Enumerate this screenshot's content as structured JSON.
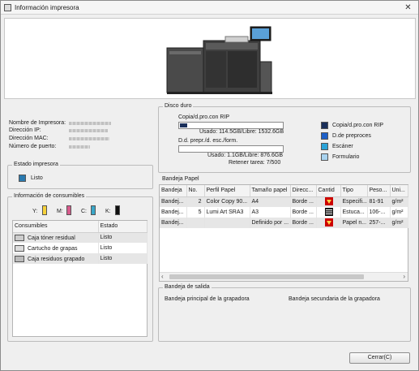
{
  "window": {
    "title": "Información impresora",
    "close_glyph": "✕"
  },
  "printer": {
    "name_label": "Nombre de Impresora:",
    "ip_label": "Dirección IP:",
    "mac_label": "Dirección MAC:",
    "port_label": "Número de puerto:"
  },
  "status": {
    "legend": "Estado impresora",
    "value": "Listo",
    "color": "#2a7ab0"
  },
  "consumables": {
    "legend": "Información de consumibles",
    "toners": [
      {
        "label": "Y:",
        "color": "#f6d13a",
        "level": 0.85
      },
      {
        "label": "M:",
        "color": "#d75b8c",
        "level": 0.85
      },
      {
        "label": "C:",
        "color": "#3aa7c9",
        "level": 0.85
      },
      {
        "label": "K:",
        "color": "#111111",
        "level": 0.85
      }
    ],
    "columns": [
      "Consumibles",
      "Estado"
    ],
    "rows": [
      {
        "name": "Caja tóner residual",
        "state": "Listo"
      },
      {
        "name": "Cartucho de grapas",
        "state": "Listo"
      },
      {
        "name": "Caja residuos grapado",
        "state": "Listo"
      }
    ]
  },
  "disk": {
    "legend": "Disco duro",
    "copy_label": "Copia/d.pro.con RIP",
    "copy_usage": "Usado: 114.5GB/Libre: 1532.6GB",
    "copy_fraction": 0.07,
    "form_label": "D.d. prepr./d. esc./form.",
    "form_usage": "Usado: 1.1GB/Libre: 876.6GB",
    "form_fraction": 0.0,
    "retain": "Retener tarea: 7/500",
    "legend_items": [
      {
        "label": "Copia/d.pro.con RIP",
        "color": "#1a2f5a"
      },
      {
        "label": "D.de preproces",
        "color": "#1d60c8"
      },
      {
        "label": "Escáner",
        "color": "#2ba3d8"
      },
      {
        "label": "Formulario",
        "color": "#a9d3ef"
      }
    ]
  },
  "trays": {
    "legend": "Bandeja Papel",
    "columns": [
      "Bandeja",
      "No.",
      "Perfil Papel",
      "Tamaño papel",
      "Direcc...",
      "Cantid",
      "Tipo",
      "Peso...",
      "Uni..."
    ],
    "rows": [
      {
        "tray": "Bandej...",
        "no": "2",
        "profile": "Color Copy 90...",
        "size": "A4",
        "dir": "Borde ...",
        "qty": "red",
        "type": "Especifi...",
        "weight": "81-91",
        "unit": "g/m²"
      },
      {
        "tray": "Bandej...",
        "no": "5",
        "profile": "Lumi Art SRA3",
        "size": "A3",
        "dir": "Borde ...",
        "qty": "full",
        "type": "Estuca...",
        "weight": "106-...",
        "unit": "g/m²"
      },
      {
        "tray": "Bandej...",
        "no": "",
        "profile": "",
        "size": "Definido por ...",
        "dir": "Borde ...",
        "qty": "red",
        "type": "Papel n...",
        "weight": "257-...",
        "unit": "g/m²"
      }
    ]
  },
  "output": {
    "legend": "Bandeja de salida",
    "main": "Bandeja principal de la grapadora",
    "secondary": "Bandeja secundaria de la grapadora"
  },
  "close_button": "Cerrar(C)"
}
